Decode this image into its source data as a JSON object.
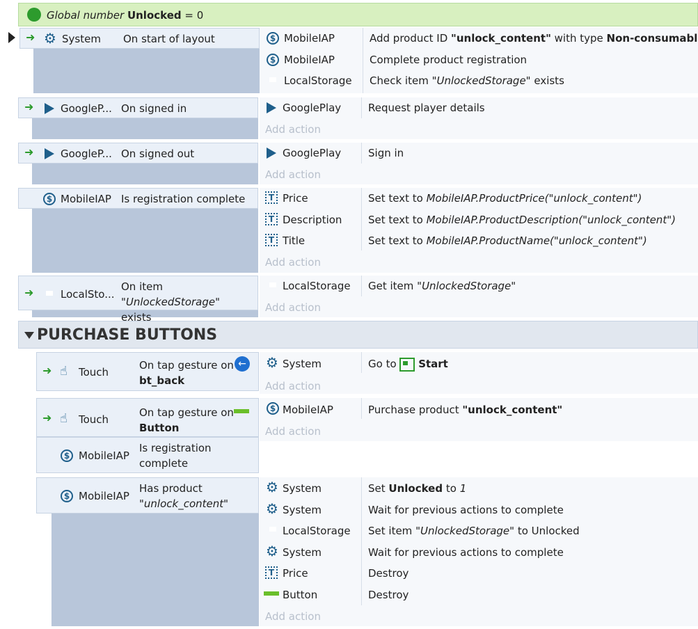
{
  "global": {
    "italic": "Global number",
    "name": "Unlocked",
    "rest": "= 0"
  },
  "e1": {
    "obj": "System",
    "cond": "On start of layout",
    "actions": [
      {
        "obj": "MobileIAP",
        "pre": "Add product ID ",
        "b1": "\"unlock_content\"",
        "mid": " with type ",
        "b2": "Non-consumable"
      },
      {
        "obj": "MobileIAP",
        "text": "Complete product registration"
      },
      {
        "obj": "LocalStorage",
        "pre": "Check item ",
        "it": "\"UnlockedStorage\"",
        "post": " exists"
      }
    ]
  },
  "e2": {
    "obj": "GoogleP...",
    "cond": "On signed in",
    "aobj": "GooglePlay",
    "atext": "Request player details",
    "add": "Add action"
  },
  "e3": {
    "obj": "GoogleP...",
    "cond": "On signed out",
    "aobj": "GooglePlay",
    "atext": "Sign in",
    "add": "Add action"
  },
  "e4": {
    "obj": "MobileIAP",
    "cond": "Is registration complete",
    "add": "Add action",
    "actions": [
      {
        "obj": "Price",
        "pre": "Set text to ",
        "it": "MobileIAP.ProductPrice(\"unlock_content\")"
      },
      {
        "obj": "Description",
        "pre": "Set text to ",
        "it": "MobileIAP.ProductDescription(\"unlock_content\")"
      },
      {
        "obj": "Title",
        "pre": "Set text to ",
        "it": "MobileIAP.ProductName(\"unlock_content\")"
      }
    ]
  },
  "e5": {
    "obj": "LocalSto...",
    "cond_pre": "On item ",
    "cond_it": "\"UnlockedStorage\"",
    "cond_post": "exists",
    "aobj": "LocalStorage",
    "apre": "Get item ",
    "ait": "\"UnlockedStorage\"",
    "add": "Add action"
  },
  "group": {
    "title": "PURCHASE BUTTONS"
  },
  "e6": {
    "obj": "Touch",
    "cond": "On tap gesture on",
    "condb": "bt_back",
    "aobj": "System",
    "apre": "Go to ",
    "ab": "Start",
    "add": "Add action"
  },
  "e7": {
    "obj": "Touch",
    "cond": "On tap gesture on",
    "condb": "Button",
    "obj2": "MobileIAP",
    "cond2": "Is registration complete",
    "aobj": "MobileIAP",
    "apre": "Purchase product ",
    "ab": "\"unlock_content\"",
    "add": "Add action"
  },
  "e8": {
    "obj": "MobileIAP",
    "cond": "Has product",
    "condit": "\"unlock_content\"",
    "add": "Add action",
    "actions": [
      {
        "obj": "System",
        "pre": "Set ",
        "b": "Unlocked",
        "mid": " to ",
        "it": "1"
      },
      {
        "obj": "System",
        "text": "Wait for previous actions to complete"
      },
      {
        "obj": "LocalStorage",
        "pre": "Set item ",
        "it": "\"UnlockedStorage\"",
        "post": " to Unlocked"
      },
      {
        "obj": "System",
        "text": "Wait for previous actions to complete"
      },
      {
        "obj": "Price",
        "text": "Destroy"
      },
      {
        "obj": "Button",
        "text": "Destroy"
      }
    ]
  }
}
